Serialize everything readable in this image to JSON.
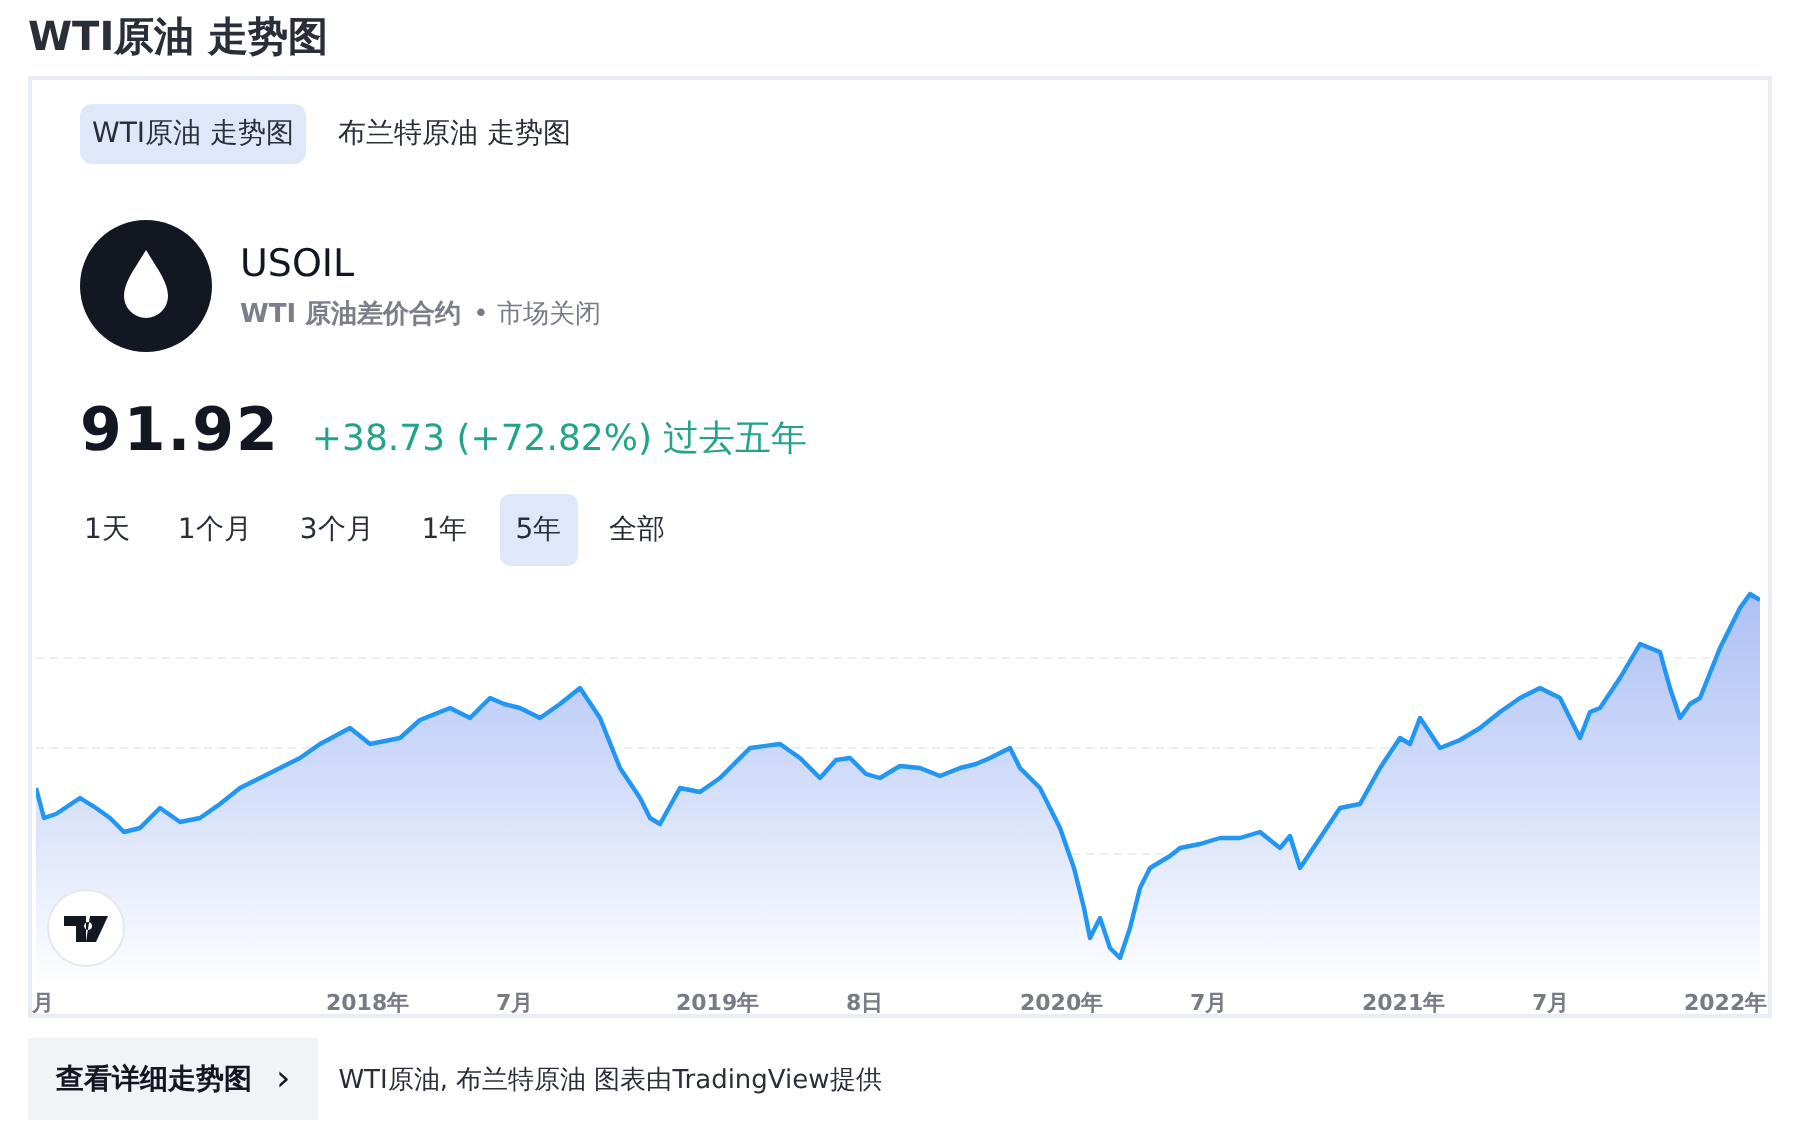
{
  "page_title": "WTI原油 走势图",
  "tabs": [
    {
      "label": "WTI原油 走势图",
      "selected": true
    },
    {
      "label": "布兰特原油 走势图",
      "selected": false
    }
  ],
  "symbol": {
    "ticker": "USOIL",
    "description": "WTI 原油差价合约",
    "market_status": "• 市场关闭"
  },
  "quote": {
    "price": "91.92",
    "change": "+38.73 (+72.82%) 过去五年"
  },
  "ranges": [
    {
      "label": "1天",
      "selected": false
    },
    {
      "label": "1个月",
      "selected": false
    },
    {
      "label": "3个月",
      "selected": false
    },
    {
      "label": "1年",
      "selected": false
    },
    {
      "label": "5年",
      "selected": true
    },
    {
      "label": "全部",
      "selected": false
    }
  ],
  "x_labels": [
    "月",
    "2018年",
    "7月",
    "2019年",
    "8日",
    "2020年",
    "7月",
    "2021年",
    "7月",
    "2022年"
  ],
  "footer": {
    "button": "查看详细走势图",
    "chevron": "›",
    "credit": "WTI原油, 布兰特原油 图表由TradingView提供"
  }
}
